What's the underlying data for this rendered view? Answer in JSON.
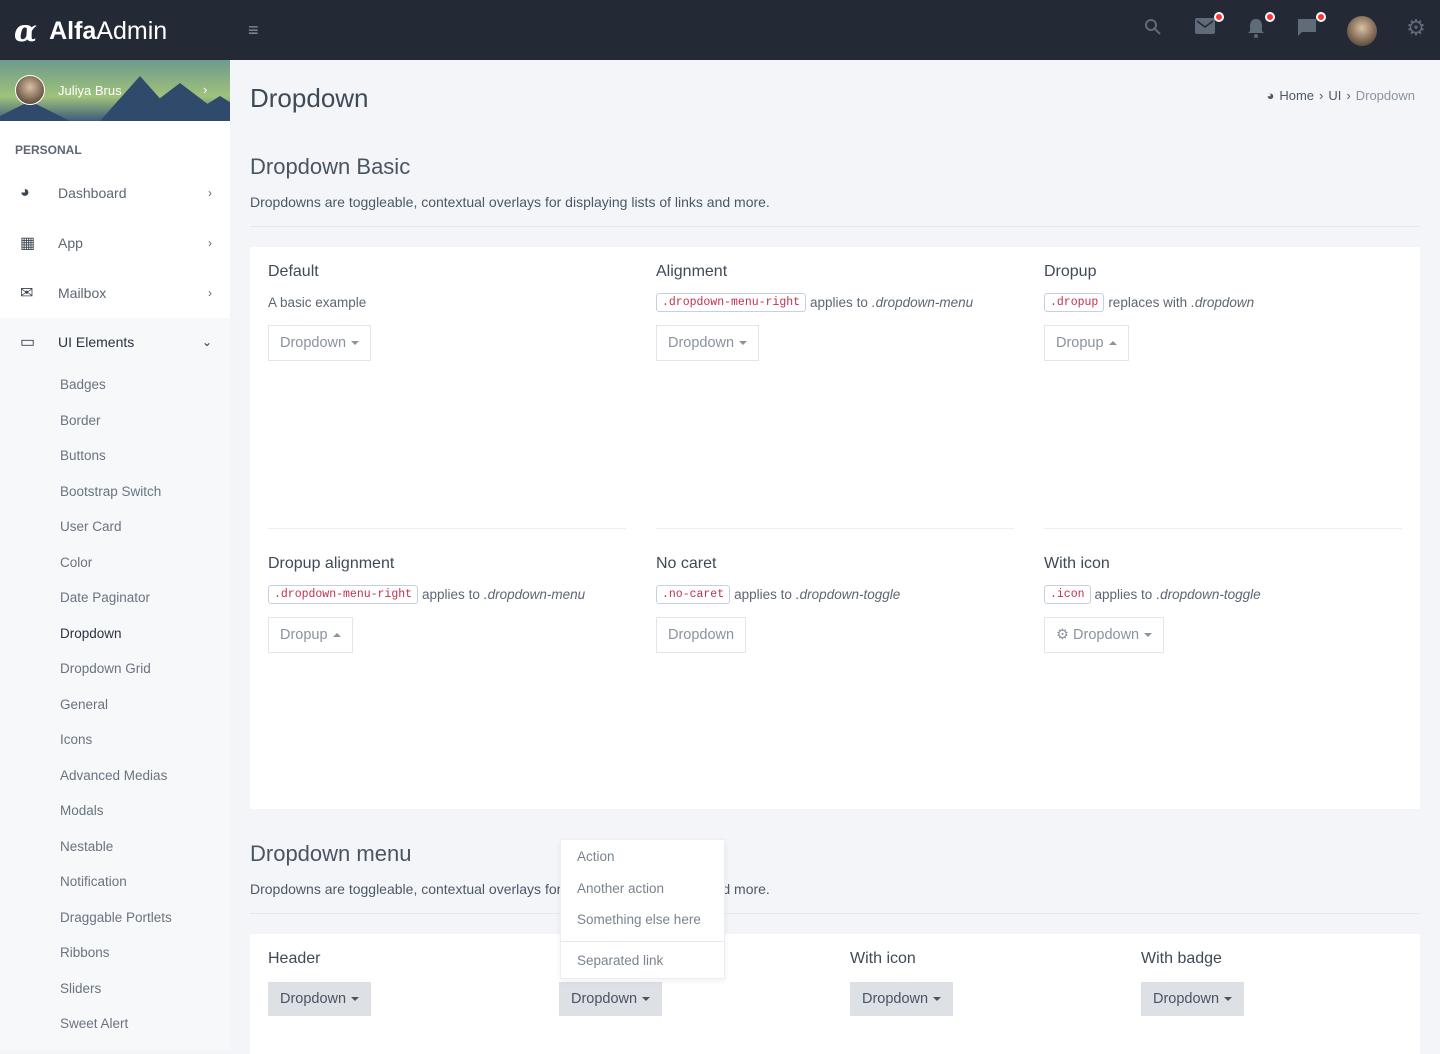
{
  "brand": {
    "logo_mark": "α",
    "name_bold": "Alfa",
    "name_light": "Admin"
  },
  "topbar": {
    "icons": [
      "menu-icon",
      "search-icon",
      "mail-icon",
      "bell-icon",
      "chat-icon",
      "avatar",
      "gear-icon"
    ]
  },
  "user": {
    "name": "Juliya Brus"
  },
  "sidebar": {
    "section": "PERSONAL",
    "items": [
      {
        "label": "Dashboard",
        "icon": "dashboard-icon"
      },
      {
        "label": "App",
        "icon": "grid-icon"
      },
      {
        "label": "Mailbox",
        "icon": "mail-icon"
      },
      {
        "label": "UI Elements",
        "icon": "laptop-icon"
      }
    ],
    "sub_items": [
      "Badges",
      "Border",
      "Buttons",
      "Bootstrap Switch",
      "User Card",
      "Color",
      "Date Paginator",
      "Dropdown",
      "Dropdown Grid",
      "General",
      "Icons",
      "Advanced Medias",
      "Modals",
      "Nestable",
      "Notification",
      "Draggable Portlets",
      "Ribbons",
      "Sliders",
      "Sweet Alert"
    ],
    "active": "Dropdown"
  },
  "page": {
    "title": "Dropdown",
    "breadcrumb": [
      "Home",
      "UI",
      "Dropdown"
    ]
  },
  "basic": {
    "title": "Dropdown Basic",
    "desc": "Dropdowns are toggleable, contextual overlays for displaying lists of links and more.",
    "cells": [
      {
        "title": "Default",
        "text": "A basic example",
        "code": "",
        "suffix": "",
        "em": "",
        "button": "Dropdown",
        "caret": "down"
      },
      {
        "title": "Alignment",
        "code": ".dropdown-menu-right",
        "suffix": "applies to",
        "em": ".dropdown-menu",
        "button": "Dropdown",
        "caret": "down"
      },
      {
        "title": "Dropup",
        "code": ".dropup",
        "suffix": "replaces with",
        "em": ".dropdown",
        "button": "Dropup",
        "caret": "up"
      },
      {
        "title": "Dropup alignment",
        "code": ".dropdown-menu-right",
        "suffix": "applies to",
        "em": ".dropdown-menu",
        "button": "Dropup",
        "caret": "up"
      },
      {
        "title": "No caret",
        "code": ".no-caret",
        "suffix": "applies to",
        "em": ".dropdown-toggle",
        "button": "Dropdown",
        "caret": "none"
      },
      {
        "title": "With icon",
        "code": ".icon",
        "suffix": "applies to",
        "em": ".dropdown-toggle",
        "button": "Dropdown",
        "caret": "down",
        "icon": "gear-icon"
      }
    ]
  },
  "menu_section": {
    "title": "Dropdown menu",
    "desc": "Dropdowns are toggleable, contextual overlays for displaying lists of links and more.",
    "cells": [
      {
        "title": "Header",
        "button": "Dropdown"
      },
      {
        "title": "",
        "button": "Dropdown"
      },
      {
        "title": "With icon",
        "button": "Dropdown"
      },
      {
        "title": "With badge",
        "button": "Dropdown"
      }
    ]
  },
  "open_menu": {
    "items": [
      "Action",
      "Another action",
      "Something else here"
    ],
    "separated": "Separated link"
  }
}
